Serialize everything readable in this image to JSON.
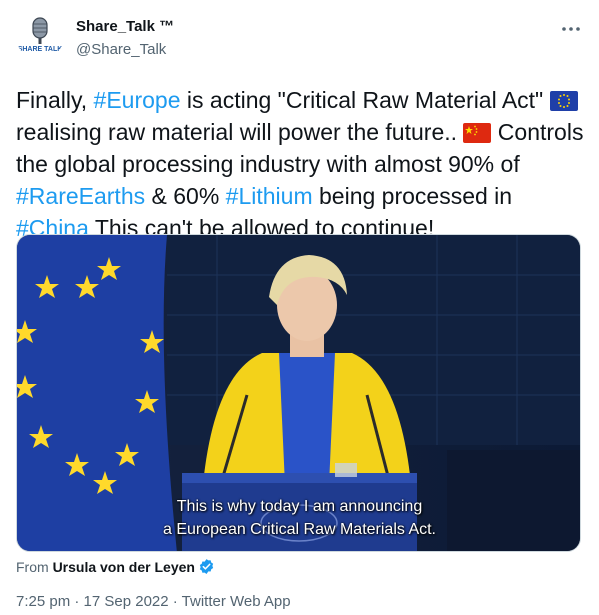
{
  "author": {
    "name": "Share_Talk ™",
    "handle": "@Share_Talk",
    "avatar_text": "SHARE TALK"
  },
  "tweet": {
    "seg1": "Finally, ",
    "tag_europe": "#Europe",
    "seg2": " is acting \"Critical Raw Material Act\" ",
    "seg3": " realising raw material will power the future.. ",
    "seg4": " Controls the global processing industry with almost 90% of ",
    "tag_rare": "#RareEarths",
    "seg5": " & 60% ",
    "tag_lithium": "#Lithium",
    "seg6": " being processed in ",
    "tag_china": "#China",
    "seg7": " This can't be allowed to continue!"
  },
  "media": {
    "caption_line1": "This is why today I am announcing",
    "caption_line2": "a European Critical Raw Materials Act."
  },
  "source": {
    "prefix": "From ",
    "name": "Ursula von der Leyen"
  },
  "meta": "7:25 pm · 17 Sep 2022 · Twitter Web App",
  "icons": [
    "more-dots-icon",
    "eu-flag-emoji-icon",
    "china-flag-emoji-icon",
    "verified-badge-icon"
  ],
  "colors": {
    "link": "#1d9bf0",
    "muted": "#536471",
    "text": "#0f1419"
  }
}
